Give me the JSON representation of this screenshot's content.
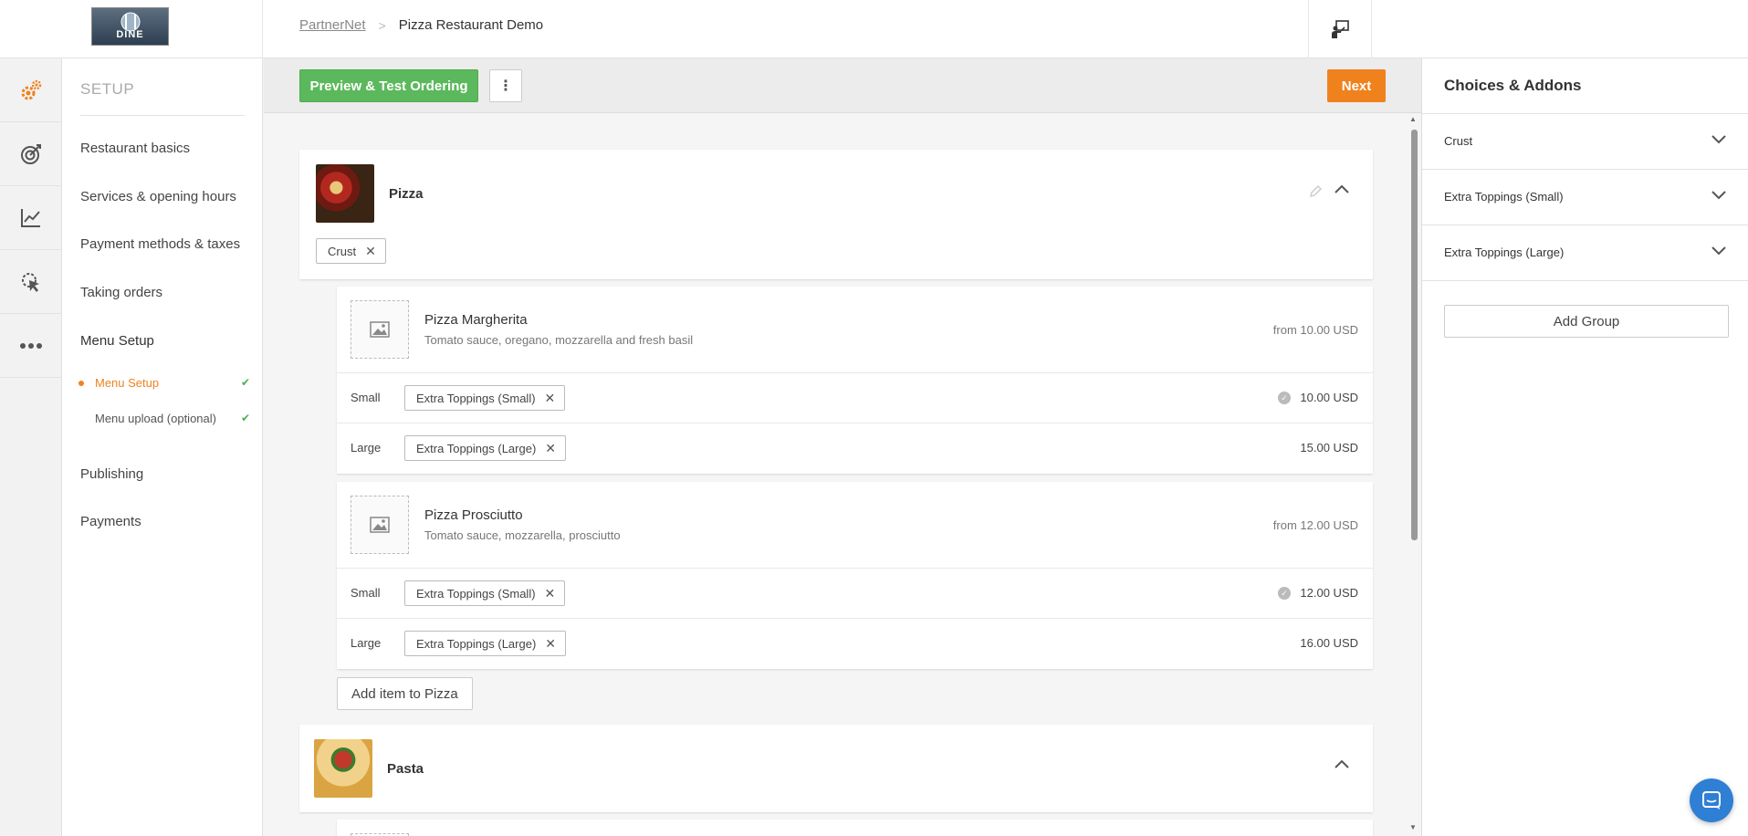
{
  "header": {
    "logo_text": "DINE",
    "breadcrumb": {
      "root": "PartnerNet",
      "separator": ">",
      "current": "Pizza Restaurant Demo"
    }
  },
  "rail": {
    "icons": [
      "settings-gears-icon",
      "target-icon",
      "chart-icon",
      "cursor-click-icon",
      "more-dots-icon"
    ]
  },
  "sidebar": {
    "title": "SETUP",
    "items": [
      {
        "label": "Restaurant basics"
      },
      {
        "label": "Services & opening hours"
      },
      {
        "label": "Payment methods & taxes"
      },
      {
        "label": "Taking orders"
      },
      {
        "label": "Menu Setup"
      },
      {
        "label": "Publishing"
      },
      {
        "label": "Payments"
      }
    ],
    "sub_items": [
      {
        "label": "Menu Setup",
        "status": "done",
        "active": true
      },
      {
        "label": "Menu upload (optional)",
        "status": "done",
        "active": false
      }
    ]
  },
  "toolbar": {
    "preview_label": "Preview & Test Ordering",
    "more_label": "⋮",
    "next_label": "Next"
  },
  "menu": {
    "categories": [
      {
        "title": "Pizza",
        "tags": [
          {
            "label": "Crust"
          }
        ],
        "items": [
          {
            "name": "Pizza Margherita",
            "description": "Tomato sauce, oregano, mozzarella and fresh basil",
            "from_price": "from 10.00 USD",
            "sizes": [
              {
                "size": "Small",
                "tag": "Extra Toppings (Small)",
                "price": "10.00 USD",
                "default": true
              },
              {
                "size": "Large",
                "tag": "Extra Toppings (Large)",
                "price": "15.00 USD",
                "default": false
              }
            ]
          },
          {
            "name": "Pizza Prosciutto",
            "description": "Tomato sauce, mozzarella, prosciutto",
            "from_price": "from 12.00 USD",
            "sizes": [
              {
                "size": "Small",
                "tag": "Extra Toppings (Small)",
                "price": "12.00 USD",
                "default": true
              },
              {
                "size": "Large",
                "tag": "Extra Toppings (Large)",
                "price": "16.00 USD",
                "default": false
              }
            ]
          }
        ],
        "add_item_label": "Add item to Pizza"
      },
      {
        "title": "Pasta"
      }
    ]
  },
  "right_panel": {
    "title": "Choices & Addons",
    "groups": [
      {
        "label": "Crust"
      },
      {
        "label": "Extra Toppings (Small)"
      },
      {
        "label": "Extra Toppings (Large)"
      }
    ],
    "add_group_label": "Add Group"
  },
  "colors": {
    "accent_orange": "#f0821e",
    "preview_green": "#5cb85c",
    "chat_blue": "#2f7fd4",
    "check_green": "#4caf50"
  }
}
